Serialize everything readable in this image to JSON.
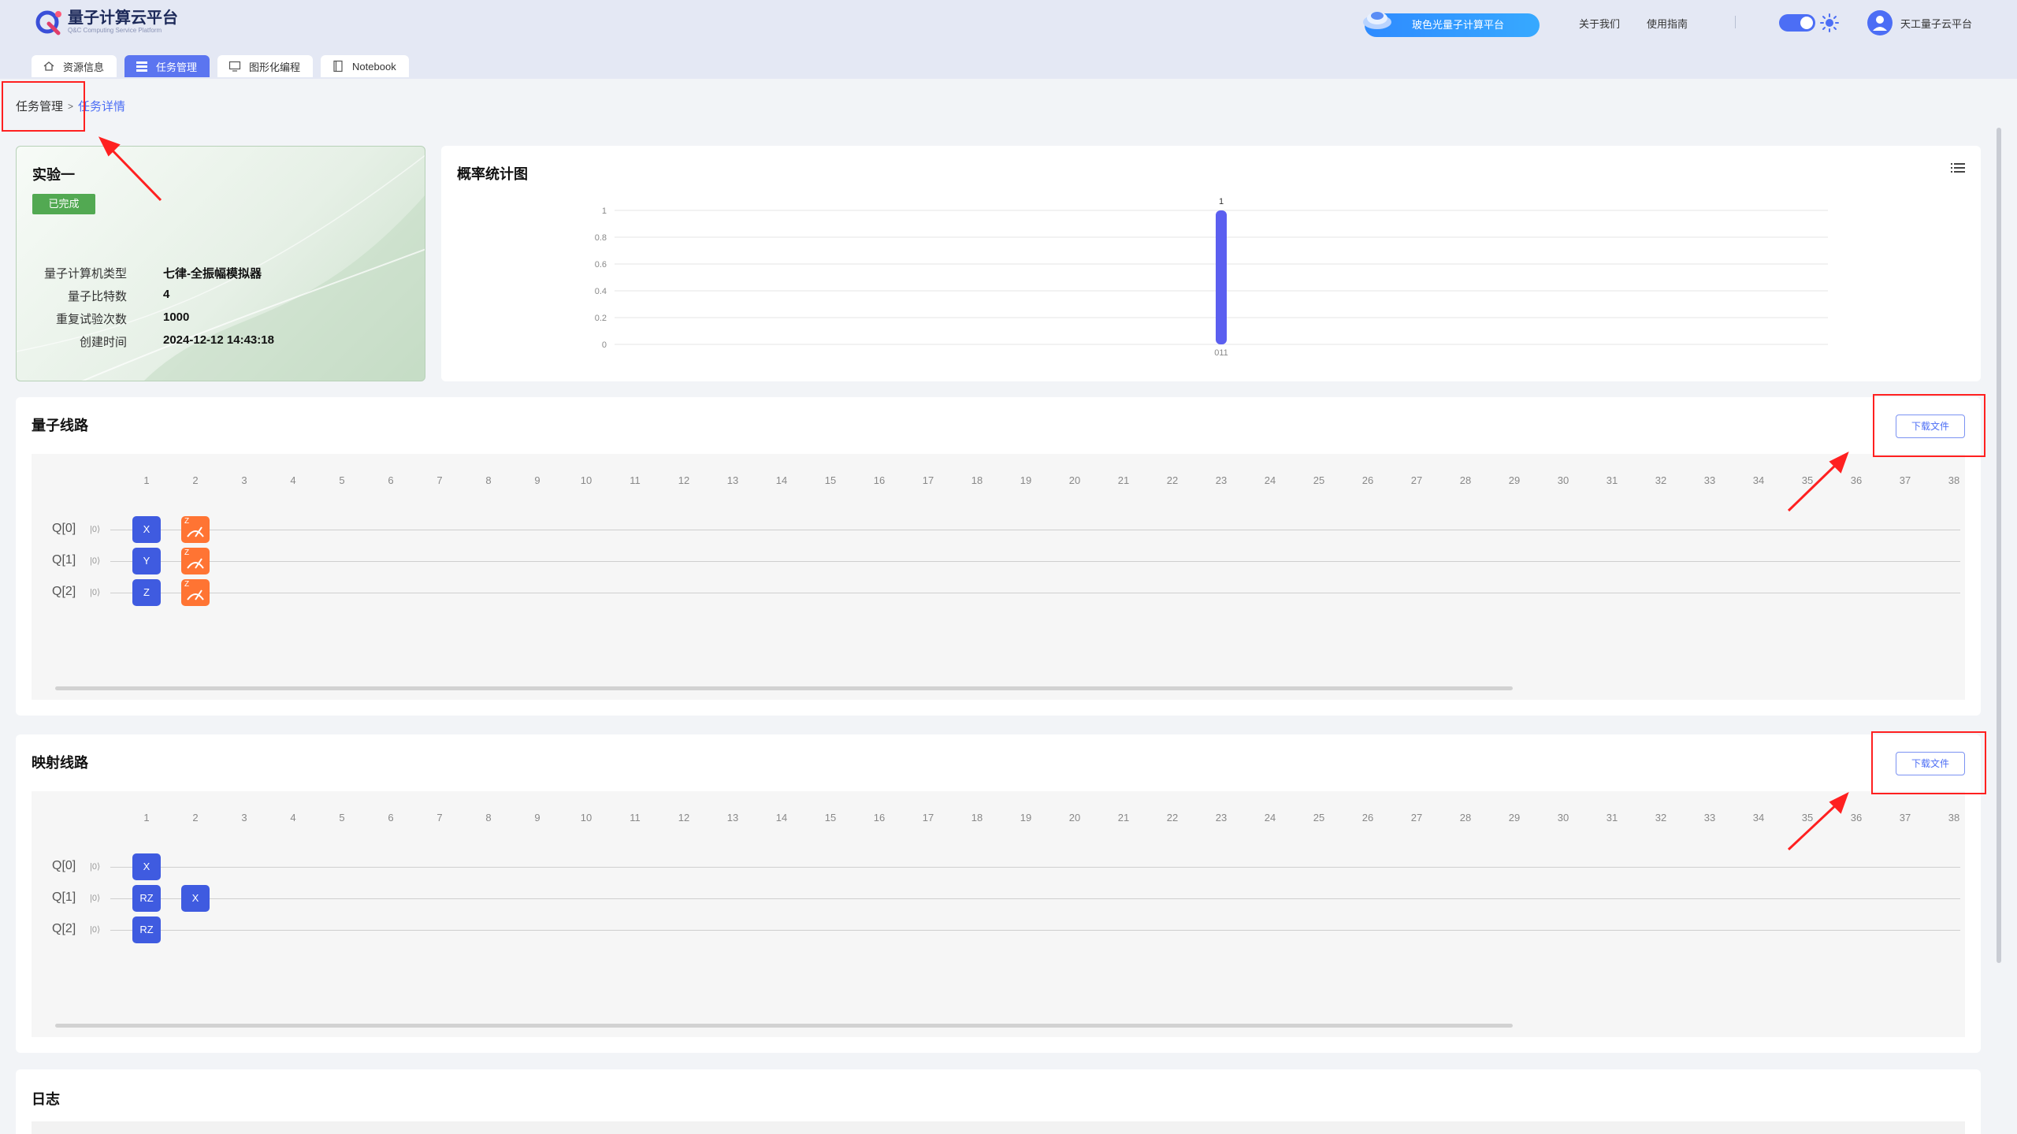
{
  "header": {
    "logo_title": "量子计算云平台",
    "logo_subtitle": "Q&C Computing Service Platform",
    "platform_button": "玻色光量子计算平台",
    "about": "关于我们",
    "guide": "使用指南",
    "user_name": "天工量子云平台",
    "accent": "#4c6ef5"
  },
  "tabs": [
    {
      "label": "资源信息",
      "icon": "home-icon",
      "active": false
    },
    {
      "label": "任务管理",
      "icon": "list-icon",
      "active": true
    },
    {
      "label": "图形化编程",
      "icon": "monitor-icon",
      "active": false
    },
    {
      "label": "Notebook",
      "icon": "notebook-icon",
      "active": false
    }
  ],
  "breadcrumb": {
    "home": "任务管理",
    "separator": ">",
    "current": "任务详情"
  },
  "experiment": {
    "title": "实验一",
    "status": "已完成",
    "status_color": "#52a952",
    "fields": [
      {
        "label": "量子计算机类型",
        "value": "七律-全振幅模拟器"
      },
      {
        "label": "量子比特数",
        "value": "4"
      },
      {
        "label": "重复试验次数",
        "value": "1000"
      },
      {
        "label": "创建时间",
        "value": "2024-12-12 14:43:18"
      }
    ]
  },
  "probability": {
    "title": "概率统计图",
    "chart_data": {
      "type": "bar",
      "categories": [
        "011"
      ],
      "values": [
        1
      ],
      "data_labels": [
        "1"
      ],
      "yticks": [
        "0",
        "0.2",
        "0.4",
        "0.6",
        "0.8",
        "1"
      ],
      "ylim": [
        0,
        1
      ],
      "bar_color": "#5b5ff0",
      "grid": true
    }
  },
  "quantum_circuit": {
    "title": "量子线路",
    "download_label": "下载文件",
    "columns": [
      "1",
      "2",
      "3",
      "4",
      "5",
      "6",
      "7",
      "8",
      "9",
      "10",
      "11",
      "12",
      "13",
      "14",
      "15",
      "16",
      "17",
      "18",
      "19",
      "20",
      "21",
      "22",
      "23",
      "24",
      "25",
      "26",
      "27",
      "28",
      "29",
      "30",
      "31",
      "32",
      "33",
      "34",
      "35",
      "36",
      "37",
      "38"
    ],
    "qubits": [
      {
        "label": "Q[0]",
        "ket": "|0⟩"
      },
      {
        "label": "Q[1]",
        "ket": "|0⟩"
      },
      {
        "label": "Q[2]",
        "ket": "|0⟩"
      }
    ],
    "gates": [
      {
        "qubit": 0,
        "col": 1,
        "label": "X",
        "kind": "gate"
      },
      {
        "qubit": 1,
        "col": 1,
        "label": "Y",
        "kind": "gate"
      },
      {
        "qubit": 2,
        "col": 1,
        "label": "Z",
        "kind": "gate"
      },
      {
        "qubit": 0,
        "col": 2,
        "label": "Z",
        "kind": "measure"
      },
      {
        "qubit": 1,
        "col": 2,
        "label": "Z",
        "kind": "measure"
      },
      {
        "qubit": 2,
        "col": 2,
        "label": "Z",
        "kind": "measure"
      }
    ]
  },
  "mapped_circuit": {
    "title": "映射线路",
    "download_label": "下载文件",
    "columns": [
      "1",
      "2",
      "3",
      "4",
      "5",
      "6",
      "7",
      "8",
      "9",
      "10",
      "11",
      "12",
      "13",
      "14",
      "15",
      "16",
      "17",
      "18",
      "19",
      "20",
      "21",
      "22",
      "23",
      "24",
      "25",
      "26",
      "27",
      "28",
      "29",
      "30",
      "31",
      "32",
      "33",
      "34",
      "35",
      "36",
      "37",
      "38"
    ],
    "qubits": [
      {
        "label": "Q[0]",
        "ket": "|0⟩"
      },
      {
        "label": "Q[1]",
        "ket": "|0⟩"
      },
      {
        "label": "Q[2]",
        "ket": "|0⟩"
      }
    ],
    "gates": [
      {
        "qubit": 0,
        "col": 1,
        "label": "X",
        "kind": "gate"
      },
      {
        "qubit": 1,
        "col": 1,
        "label": "RZ",
        "kind": "gate"
      },
      {
        "qubit": 1,
        "col": 2,
        "label": "X",
        "kind": "gate"
      },
      {
        "qubit": 2,
        "col": 1,
        "label": "RZ",
        "kind": "gate"
      }
    ]
  },
  "log": {
    "title": "日志"
  }
}
